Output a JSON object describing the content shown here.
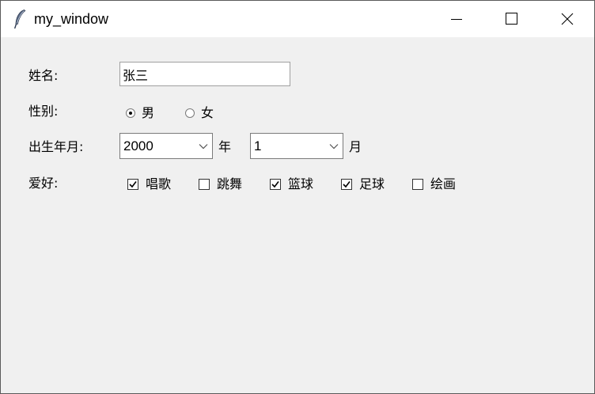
{
  "window": {
    "title": "my_window"
  },
  "form": {
    "name_label": "姓名:",
    "name_value": "张三",
    "gender_label": "性别:",
    "gender_options": [
      {
        "label": "男",
        "selected": true
      },
      {
        "label": "女",
        "selected": false
      }
    ],
    "birth_label": "出生年月:",
    "year_value": "2000",
    "year_unit": "年",
    "month_value": "1",
    "month_unit": "月",
    "hobby_label": "爱好:",
    "hobbies": [
      {
        "label": "唱歌",
        "checked": true
      },
      {
        "label": "跳舞",
        "checked": false
      },
      {
        "label": "篮球",
        "checked": true
      },
      {
        "label": "足球",
        "checked": true
      },
      {
        "label": "绘画",
        "checked": false
      }
    ]
  },
  "icons": {
    "app": "feather-icon",
    "minimize": "minimize-icon",
    "maximize": "maximize-icon",
    "close": "close-icon",
    "dropdown": "chevron-down-icon"
  }
}
